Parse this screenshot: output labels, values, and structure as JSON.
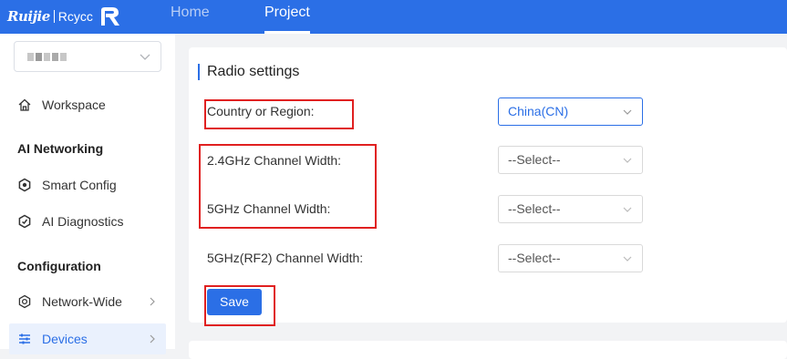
{
  "header": {
    "logo_brand": "Ruijie",
    "logo_sub": "Rcycc",
    "tabs": [
      {
        "label": "Home",
        "active": false
      },
      {
        "label": "Project",
        "active": true
      }
    ]
  },
  "sidebar": {
    "items": [
      {
        "label": "Workspace",
        "icon": "home-icon"
      },
      {
        "label": "Smart Config",
        "icon": "smart-config-icon"
      },
      {
        "label": "AI Diagnostics",
        "icon": "diagnostics-icon"
      },
      {
        "label": "Network-Wide",
        "icon": "gear-icon"
      },
      {
        "label": "Devices",
        "icon": "devices-icon"
      }
    ],
    "groups": [
      "AI Networking",
      "Configuration"
    ]
  },
  "radio_settings": {
    "title": "Radio settings",
    "rows": [
      {
        "label": "Country or Region:",
        "value": "China(CN)"
      },
      {
        "label": "2.4GHz Channel Width:",
        "value": "--Select--"
      },
      {
        "label": "5GHz Channel Width:",
        "value": "--Select--"
      },
      {
        "label": "5GHz(RF2) Channel Width:",
        "value": "--Select--"
      }
    ],
    "save_label": "Save"
  },
  "colors": {
    "primary": "#2b6fe6",
    "highlight": "#e02020",
    "background": "#f2f3f5"
  }
}
